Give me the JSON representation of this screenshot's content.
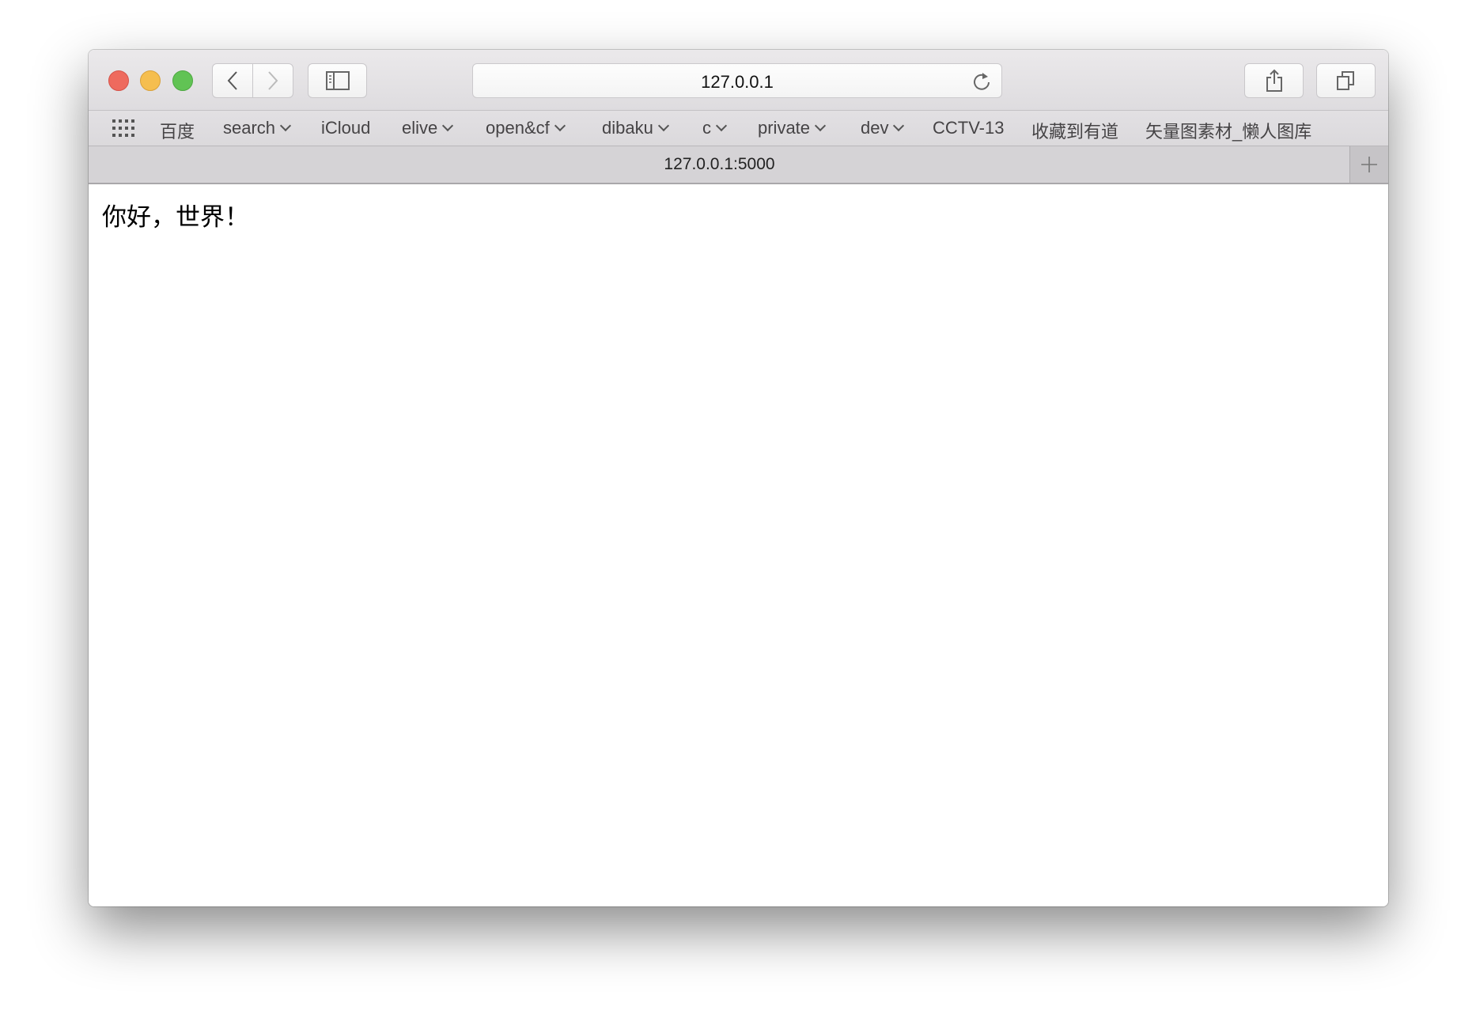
{
  "window": {
    "traffic_lights": {
      "close_color": "#ee6a5e",
      "minimize_color": "#f5be4f",
      "zoom_color": "#61c354"
    }
  },
  "toolbar": {
    "back_icon": "chevron-left",
    "forward_icon": "chevron-right",
    "sidebar_icon": "sidebar",
    "address": "127.0.0.1",
    "reload_icon": "reload",
    "share_icon": "share",
    "tabs_icon": "tabs-overview"
  },
  "bookmarks": {
    "items": [
      {
        "label": "百度",
        "has_menu": false
      },
      {
        "label": "search",
        "has_menu": true
      },
      {
        "label": "iCloud",
        "has_menu": false
      },
      {
        "label": "elive",
        "has_menu": true
      },
      {
        "label": "open&cf",
        "has_menu": true
      },
      {
        "label": "dibaku",
        "has_menu": true
      },
      {
        "label": "c",
        "has_menu": true
      },
      {
        "label": "private",
        "has_menu": true
      },
      {
        "label": "dev",
        "has_menu": true
      },
      {
        "label": "CCTV-13",
        "has_menu": false
      },
      {
        "label": "收藏到有道",
        "has_menu": false
      },
      {
        "label": "矢量图素材_懒人图库",
        "has_menu": false
      }
    ]
  },
  "tab": {
    "title": "127.0.0.1:5000"
  },
  "page": {
    "text": "你好，世界！"
  }
}
